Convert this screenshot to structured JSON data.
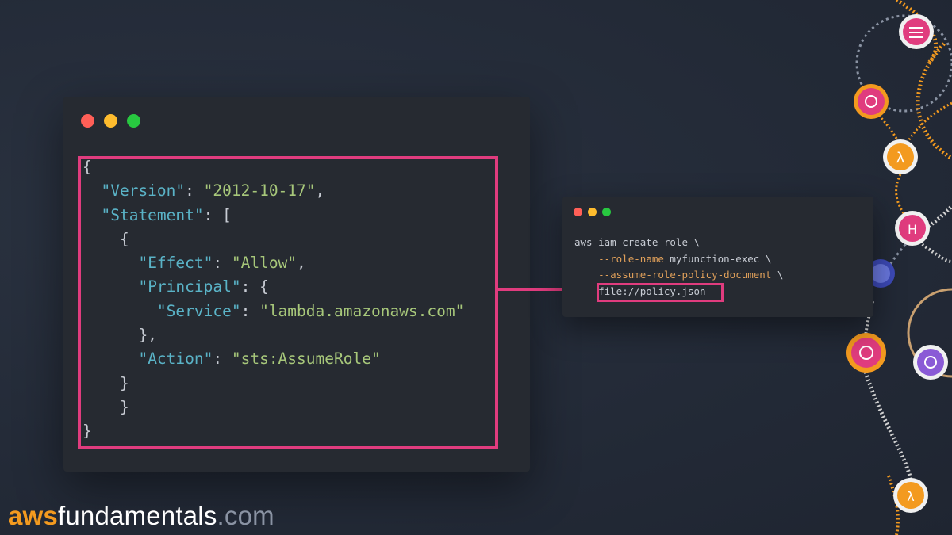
{
  "main_window": {
    "code_lines": [
      [
        {
          "t": "{",
          "c": "p"
        }
      ],
      [
        {
          "t": "  ",
          "c": "p"
        },
        {
          "t": "\"Version\"",
          "c": "k"
        },
        {
          "t": ": ",
          "c": "p"
        },
        {
          "t": "\"2012-10-17\"",
          "c": "s"
        },
        {
          "t": ",",
          "c": "p"
        }
      ],
      [
        {
          "t": "  ",
          "c": "p"
        },
        {
          "t": "\"Statement\"",
          "c": "k"
        },
        {
          "t": ": [",
          "c": "p"
        }
      ],
      [
        {
          "t": "    {",
          "c": "p"
        }
      ],
      [
        {
          "t": "      ",
          "c": "p"
        },
        {
          "t": "\"Effect\"",
          "c": "k"
        },
        {
          "t": ": ",
          "c": "p"
        },
        {
          "t": "\"Allow\"",
          "c": "s"
        },
        {
          "t": ",",
          "c": "p"
        }
      ],
      [
        {
          "t": "      ",
          "c": "p"
        },
        {
          "t": "\"Principal\"",
          "c": "k"
        },
        {
          "t": ": {",
          "c": "p"
        }
      ],
      [
        {
          "t": "        ",
          "c": "p"
        },
        {
          "t": "\"Service\"",
          "c": "k"
        },
        {
          "t": ": ",
          "c": "p"
        },
        {
          "t": "\"lambda.amazonaws.com\"",
          "c": "s"
        }
      ],
      [
        {
          "t": "      },",
          "c": "p"
        }
      ],
      [
        {
          "t": "      ",
          "c": "p"
        },
        {
          "t": "\"Action\"",
          "c": "k"
        },
        {
          "t": ": ",
          "c": "p"
        },
        {
          "t": "\"sts:AssumeRole\"",
          "c": "s"
        }
      ],
      [
        {
          "t": "    }",
          "c": "p"
        }
      ],
      [
        {
          "t": "    }",
          "c": "p"
        }
      ],
      [
        {
          "t": "}",
          "c": "p"
        }
      ]
    ]
  },
  "terminal_window": {
    "lines": [
      [
        {
          "t": "aws iam create-role \\",
          "c": "p"
        }
      ],
      [
        {
          "t": "    ",
          "c": "p"
        },
        {
          "t": "--role-name",
          "c": "flag"
        },
        {
          "t": " myfunction-exec \\",
          "c": "p"
        }
      ],
      [
        {
          "t": "    ",
          "c": "p"
        },
        {
          "t": "--assume-role-policy-document",
          "c": "flag"
        },
        {
          "t": " \\",
          "c": "p"
        }
      ],
      [
        {
          "t": "    file://policy.json",
          "c": "p"
        }
      ]
    ]
  },
  "logo": {
    "part1": "aws",
    "part2": "fundamentals",
    "part3": ".com"
  },
  "colors": {
    "accent": "#e03c7e",
    "logo_orange": "#f39a1f",
    "background": "#232a37"
  },
  "graph_icons": [
    "api-gateway-icon",
    "event-icon",
    "lambda-icon",
    "step-functions-icon",
    "cognito-icon",
    "eventbridge-icon",
    "vpc-icon",
    "lambda-icon-2"
  ]
}
